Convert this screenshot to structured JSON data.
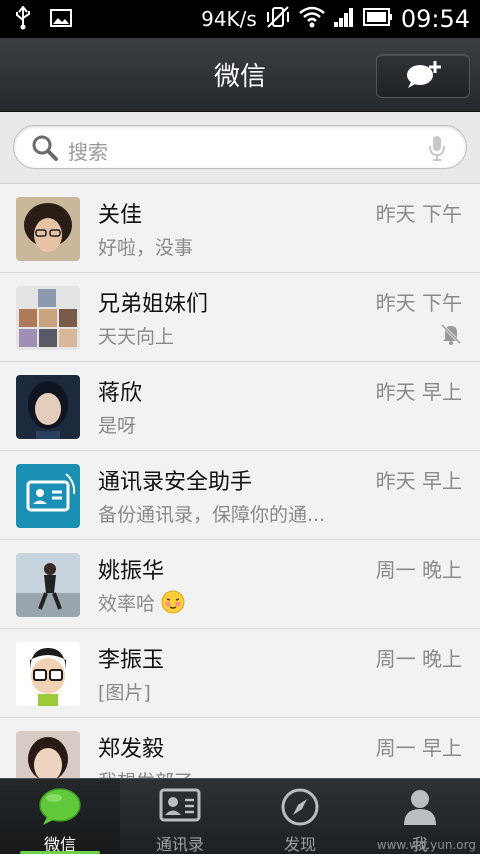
{
  "status_bar": {
    "speed": "94K/s",
    "time": "09:54"
  },
  "header": {
    "title": "微信",
    "compose_icon": "chat-bubble-plus-icon"
  },
  "search": {
    "placeholder": "搜索"
  },
  "chats": [
    {
      "name": "关佳",
      "time": "昨天 下午",
      "preview": "好啦，没事",
      "muted": false
    },
    {
      "name": "兄弟姐妹们",
      "time": "昨天 下午",
      "preview": "天天向上",
      "muted": true
    },
    {
      "name": "蒋欣",
      "time": "昨天 早上",
      "preview": "是呀",
      "muted": false
    },
    {
      "name": "通讯录安全助手",
      "time": "昨天 早上",
      "preview": "备份通讯录，保障你的通...",
      "muted": false
    },
    {
      "name": "姚振华",
      "time": "周一 晚上",
      "preview": "效率哈",
      "muted": false
    },
    {
      "name": "李振玉",
      "time": "周一 晚上",
      "preview": "[图片]",
      "muted": false
    },
    {
      "name": "郑发毅",
      "time": "周一 早上",
      "preview": "我想发部了",
      "muted": false
    }
  ],
  "tabs": [
    {
      "label": "微信",
      "icon": "chat-bubble-icon",
      "active": true
    },
    {
      "label": "通讯录",
      "icon": "contacts-card-icon",
      "active": false
    },
    {
      "label": "发现",
      "icon": "compass-icon",
      "active": false
    },
    {
      "label": "我",
      "icon": "person-icon",
      "active": false
    }
  ],
  "watermark": "www.wd.yun.org",
  "colors": {
    "accent_green": "#6fd14b",
    "header_bg": "#2f3337",
    "list_bg": "#f2f2f2"
  }
}
